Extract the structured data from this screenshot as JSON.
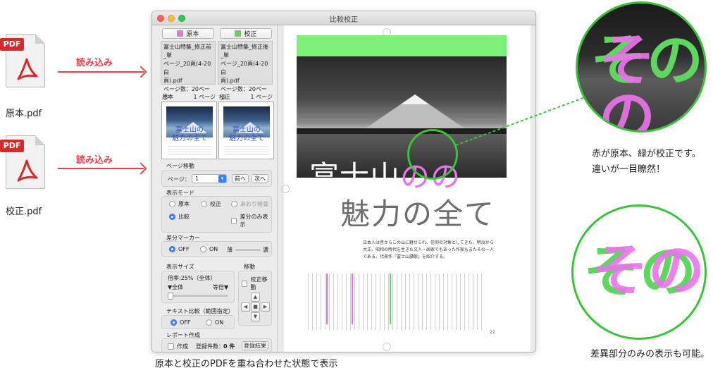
{
  "files": [
    {
      "tag": "PDF",
      "name": "原本.pdf",
      "action": "読み込み"
    },
    {
      "tag": "PDF",
      "name": "校正.pdf",
      "action": "読み込み"
    }
  ],
  "window": {
    "title": "比較校正"
  },
  "sidebar": {
    "original_button": "原本",
    "proof_button": "校正",
    "original_swatch": "#e878c8",
    "proof_swatch": "#5ed75e",
    "original_info": [
      "富士山特集_修正前_単",
      "ページ_20頁(4-20白",
      "頁).pdf",
      "ページ数：20ページ"
    ],
    "proof_info": [
      "富士山特集_修正後_単",
      "ページ_20頁(4-20白",
      "頁).pdf",
      "ページ数：20ページ"
    ],
    "original_page_label": "原本",
    "original_page_value": "1 ページ",
    "proof_page_label": "校正",
    "proof_page_value": "1 ページ",
    "thumb_title": "富士山の\n魅力の全て",
    "page_nav": {
      "label": "ページ移動",
      "page_prefix": "ページ：",
      "page_value": "1",
      "prev": "前へ",
      "next": "次へ"
    },
    "display_mode": {
      "label": "表示モード",
      "original": "原本",
      "proof": "校正",
      "aori": "あおり検査",
      "compare": "比較",
      "diff_only": "差分のみ表示"
    },
    "diff_marker": {
      "label": "差分マーカー",
      "off": "OFF",
      "on": "ON",
      "thin": "薄",
      "thick": "濃"
    },
    "display_size": {
      "label": "表示サイズ",
      "zoom": "倍率:25%（全体）",
      "whole": "▼全体",
      "actual": "等倍▼"
    },
    "move": {
      "label": "移動",
      "proof_move": "校正移動"
    },
    "text_compare": {
      "label": "テキスト比較（範囲指定）",
      "off": "OFF",
      "on": "ON"
    },
    "report": {
      "label": "レポート作成",
      "create": "作成",
      "count_label": "登録件数：",
      "count": "0 件",
      "results": "登録結果"
    }
  },
  "document": {
    "headline_1": "富士山",
    "headline_no": "の",
    "headline_2": "魅力の全て",
    "lead": "日本人は昔からこの山に魅せられ、信仰の対象としてきた。明治から大正、昭和の時代を生きた文人・画家でもあった作家もまたその一人である。代表作『富士山讃歌』を紹介する。",
    "page_number": "22"
  },
  "callouts": {
    "top_text": "その",
    "top_caption_1": "赤が原本、緑が校正です。",
    "top_caption_2": "違いが一目瞭然！",
    "bottom_text": "その",
    "bottom_caption": "差異部分のみの表示も可能。"
  },
  "bottom_caption": "原本と校正のPDFを重ね合わせた状態で表示",
  "colors": {
    "accent_red": "#e8414b",
    "accent_green": "#3bc23b",
    "diff_pink": "#ea73ea",
    "diff_green": "#5ed75e"
  }
}
